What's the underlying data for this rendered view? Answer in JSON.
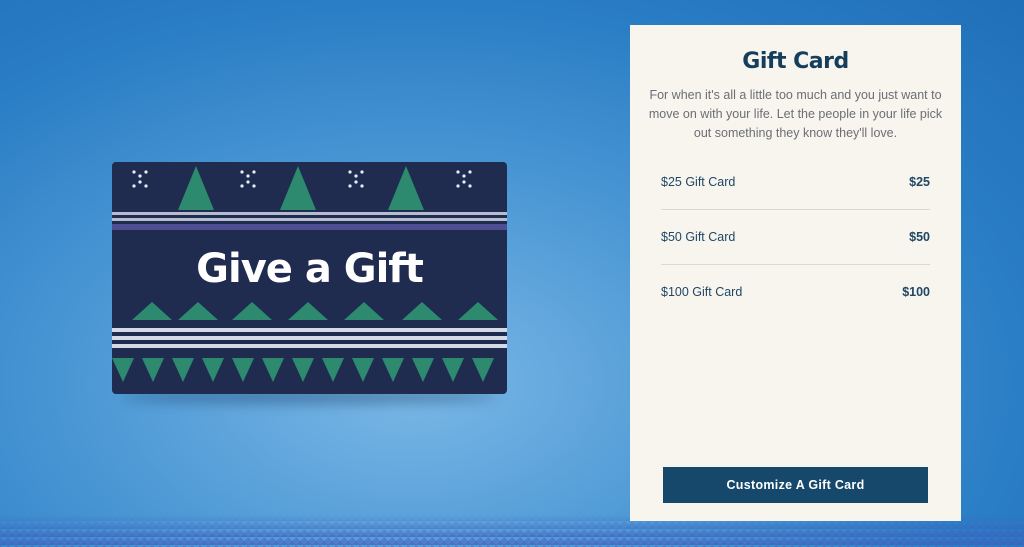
{
  "hero_card": {
    "title": "Give a Gift"
  },
  "panel": {
    "title": "Gift Card",
    "description": "For when it's all a little too much and you just want to move on with your life. Let the people in your life pick out something they know they'll love.",
    "options": [
      {
        "label": "$25 Gift Card",
        "price": "$25"
      },
      {
        "label": "$50 Gift Card",
        "price": "$50"
      },
      {
        "label": "$100 Gift Card",
        "price": "$100"
      }
    ],
    "cta_label": "Customize A Gift Card"
  },
  "colors": {
    "background": "#2a7ec5",
    "panel_bg": "#f8f4ee",
    "brand_navy": "#15486a",
    "card_bg": "#1f2b4f",
    "knit_green": "#2f8c6e"
  }
}
